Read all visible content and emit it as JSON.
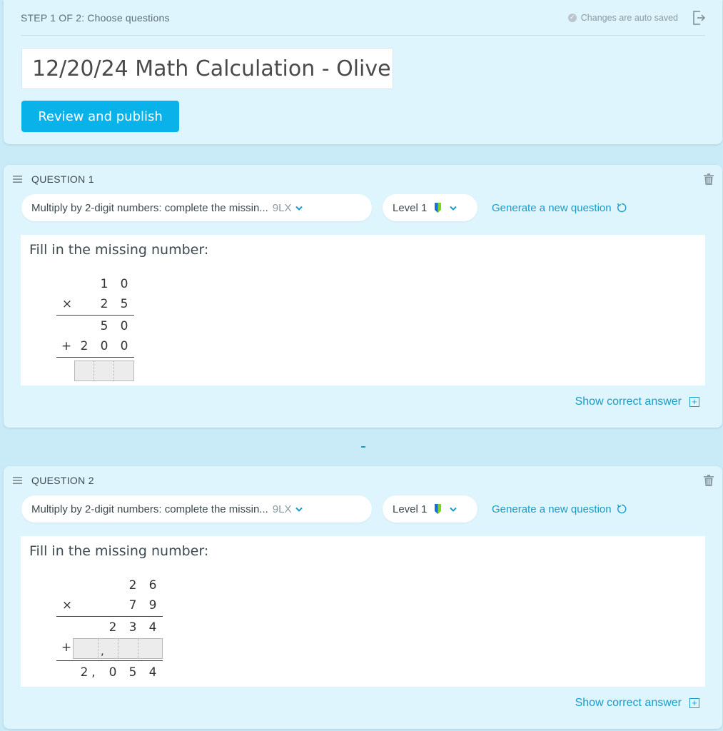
{
  "header": {
    "step_label": "STEP 1 OF 2: Choose questions",
    "autosave_text": "Changes are auto saved",
    "title_value": "12/20/24 Math Calculation - Olive",
    "publish_label": "Review and publish"
  },
  "questions": [
    {
      "title": "QUESTION 1",
      "skill_name": "Multiply by 2-digit numbers: complete the missin...",
      "skill_code": "9LX",
      "level_label": "Level 1",
      "generate_label": "Generate a new question",
      "prompt": "Fill in the missing number:",
      "problem": {
        "top": [
          "1",
          "0"
        ],
        "operator": "×",
        "multiplier": [
          "2",
          "5"
        ],
        "partial1": [
          "5",
          "0"
        ],
        "plus": "+",
        "partial2": [
          "2",
          "0",
          "0"
        ]
      },
      "show_answer_label": "Show correct answer",
      "show_answer_icon": "+"
    },
    {
      "title": "QUESTION 2",
      "skill_name": "Multiply by 2-digit numbers: complete the missin...",
      "skill_code": "9LX",
      "level_label": "Level 1",
      "generate_label": "Generate a new question",
      "prompt": "Fill in the missing number:",
      "problem": {
        "top": [
          "2",
          "6"
        ],
        "operator": "×",
        "multiplier": [
          "7",
          "9"
        ],
        "partial1": [
          "2",
          "3",
          "4"
        ],
        "plus": "+",
        "box_comma": ",",
        "result": [
          "2",
          ",",
          "0",
          "5",
          "4"
        ]
      },
      "show_answer_label": "Show correct answer",
      "show_answer_icon": "+"
    }
  ],
  "icons": {
    "check": "✓",
    "check_icon": "check-circle-icon",
    "exit_icon": "exit-icon",
    "drag_icon": "drag-handle-icon",
    "trash_icon": "trash-icon",
    "bookmark_icon": "bookmark-icon",
    "refresh_icon": "refresh-icon",
    "chevron_icon": "chevron-down-icon"
  },
  "colors": {
    "page_bg": "#c9ebf8",
    "panel_bg": "#dff5fd",
    "primary_button": "#0ab2ea",
    "link": "#1a9bc7",
    "bookmark_blue": "#1a6fd6",
    "bookmark_green": "#7ed321"
  }
}
